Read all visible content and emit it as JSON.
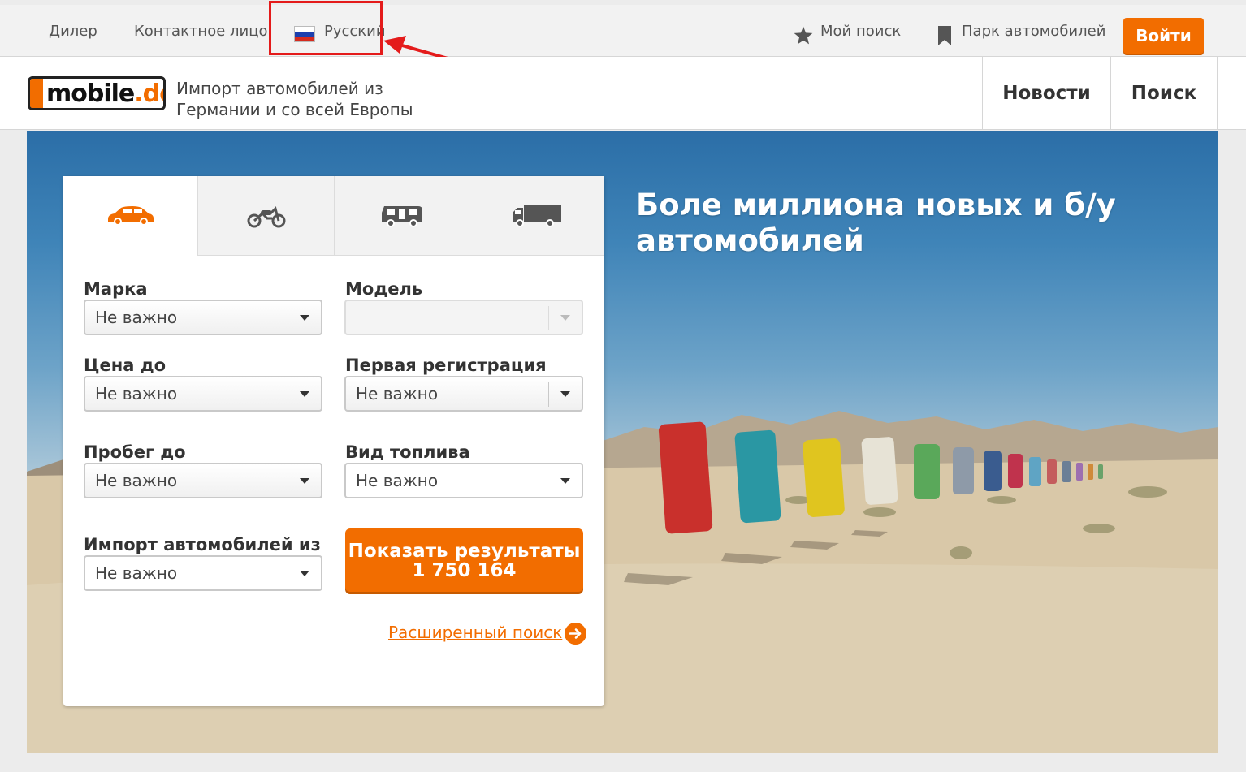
{
  "topbar": {
    "dealer": "Дилер",
    "contact": "Контактное лицо",
    "language": "Русский",
    "my_search": "Мой поиск",
    "car_park": "Парк автомобилей",
    "login": "Войти"
  },
  "header": {
    "logo_text": "mobile",
    "logo_suffix": ".de",
    "tagline_line1": "Импорт автомобилей из",
    "tagline_line2": "Германии и со всей Европы",
    "nav": {
      "news": "Новости",
      "search": "Поиск"
    }
  },
  "hero": {
    "title": "Боле миллиона новых и б/у автомобилей"
  },
  "search": {
    "tabs": [
      "car-icon",
      "motorcycle-icon",
      "camper-icon",
      "truck-icon"
    ],
    "make": {
      "label": "Марка",
      "value": "Не важно"
    },
    "model": {
      "label": "Модель",
      "value": ""
    },
    "price": {
      "label": "Цена до",
      "value": "Не важно"
    },
    "first_reg": {
      "label": "Первая регистрация",
      "value": "Не важно"
    },
    "mileage": {
      "label": "Пробег до",
      "value": "Не важно"
    },
    "fuel": {
      "label": "Вид топлива",
      "value": "Не важно"
    },
    "import": {
      "label": "Импорт автомобилей из",
      "value": "Не важно"
    },
    "show_button_line1": "Показать результаты",
    "show_button_line2": "1 750 164",
    "advanced": "Расширенный поиск"
  },
  "colors": {
    "accent": "#f26d00",
    "annotation": "#e41b1b"
  }
}
